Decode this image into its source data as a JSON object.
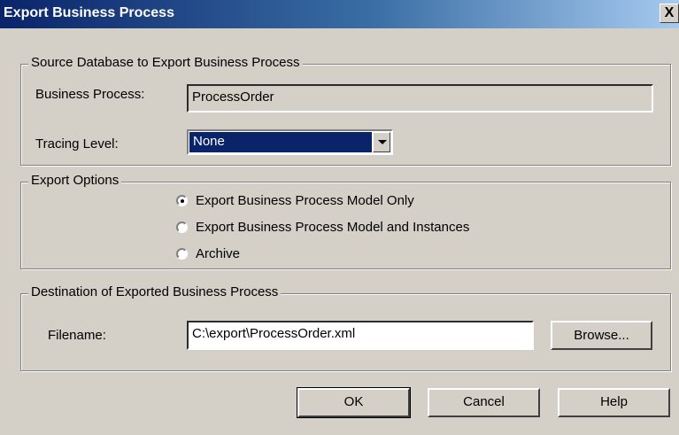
{
  "window": {
    "title": "Export Business Process",
    "close": "X"
  },
  "source": {
    "legend": "Source Database to Export Business Process",
    "business_process_label": "Business Process:",
    "business_process_value": "ProcessOrder",
    "tracing_label": "Tracing Level:",
    "tracing_value": "None"
  },
  "export_options": {
    "legend": "Export Options",
    "options": [
      {
        "label": "Export Business Process Model Only",
        "selected": true
      },
      {
        "label": "Export Business Process Model and Instances",
        "selected": false
      },
      {
        "label": "Archive",
        "selected": false
      }
    ]
  },
  "destination": {
    "legend": "Destination of Exported Business Process",
    "filename_label": "Filename:",
    "filename_value": "C:\\export\\ProcessOrder.xml",
    "browse_label": "Browse..."
  },
  "buttons": {
    "ok": "OK",
    "cancel": "Cancel",
    "help": "Help"
  }
}
